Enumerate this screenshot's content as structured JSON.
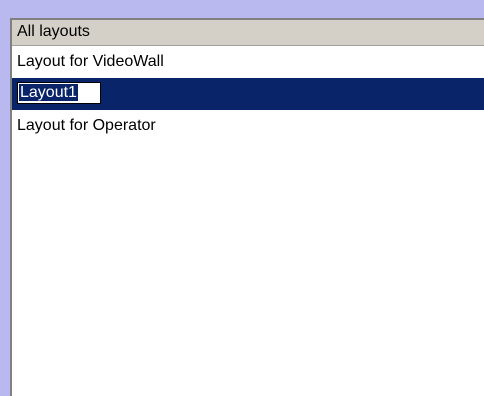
{
  "list": {
    "header": "All layouts",
    "items": [
      {
        "label": "Layout for VideoWall",
        "selected": false
      },
      {
        "label": "Layout1",
        "selected": true,
        "editing": true
      },
      {
        "label": "Layout for Operator",
        "selected": false
      }
    ]
  },
  "colors": {
    "frame": "#b9b9f0",
    "header_bg": "#d4d0c8",
    "selection_bg": "#0a246a",
    "selection_text": "#ffffff"
  }
}
